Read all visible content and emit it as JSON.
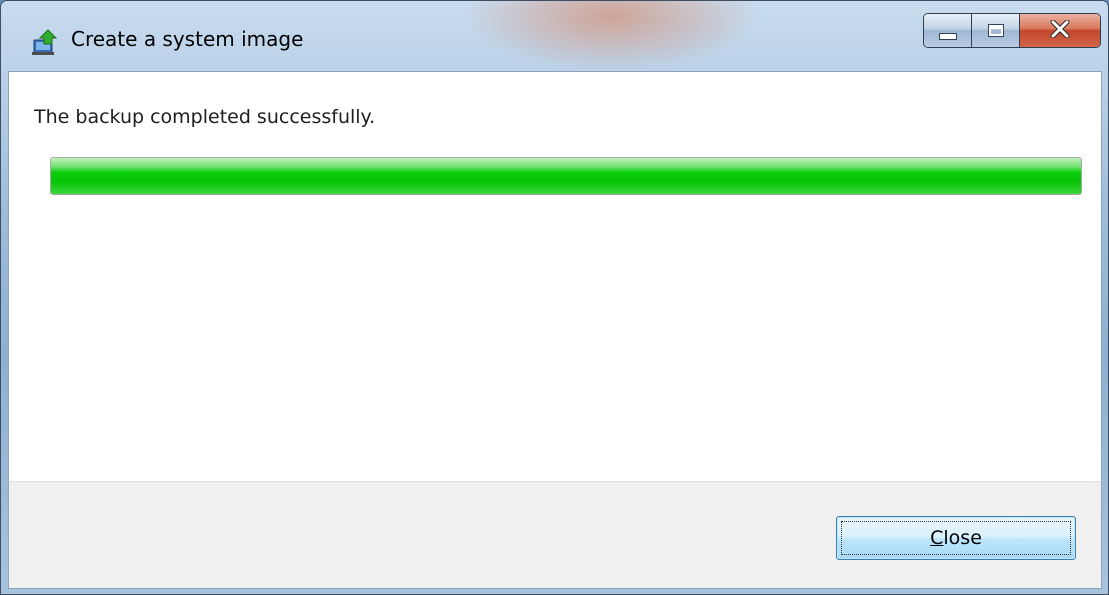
{
  "window": {
    "title": "Create a system image",
    "icon": "backup-app-icon"
  },
  "caption_buttons": {
    "minimize_icon": "minimize-icon",
    "maximize_icon": "maximize-icon",
    "close_glyph": "X"
  },
  "main": {
    "message": "The backup completed successfully.",
    "progress_percent": 100
  },
  "footer": {
    "close_button": {
      "accesskey": "C",
      "rest": "lose"
    }
  },
  "colors": {
    "progress_green": "#06c206",
    "close_red": "#c3452a",
    "button_blue": "#bee6fd"
  }
}
